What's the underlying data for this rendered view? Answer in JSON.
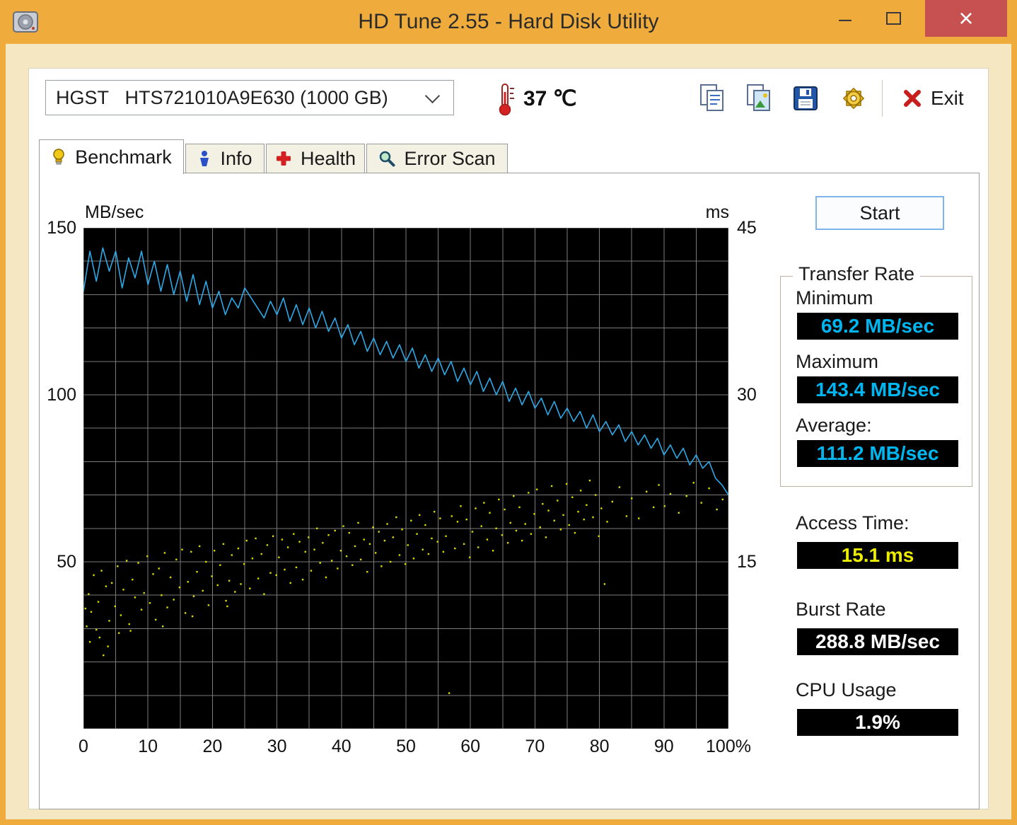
{
  "window": {
    "title": "HD Tune 2.55 - Hard Disk Utility",
    "minimize_glyph": "–",
    "close_glyph": "×"
  },
  "toolbar": {
    "drive_selector_value": "HGST   HTS721010A9E630 (1000 GB)",
    "temperature": "37 ℃",
    "exit_label": "Exit"
  },
  "tabs": [
    {
      "label": "Benchmark",
      "active": true
    },
    {
      "label": "Info",
      "active": false
    },
    {
      "label": "Health",
      "active": false
    },
    {
      "label": "Error Scan",
      "active": false
    }
  ],
  "benchmark": {
    "start_button": "Start",
    "transfer_rate": {
      "group_title": "Transfer Rate",
      "minimum_label": "Minimum",
      "minimum_value": "69.2 MB/sec",
      "maximum_label": "Maximum",
      "maximum_value": "143.4 MB/sec",
      "average_label": "Average:",
      "average_value": "111.2 MB/sec"
    },
    "access_time_label": "Access Time:",
    "access_time_value": "15.1 ms",
    "burst_rate_label": "Burst Rate",
    "burst_rate_value": "288.8 MB/sec",
    "cpu_usage_label": "CPU Usage",
    "cpu_usage_value": "1.9%"
  },
  "chart_data": {
    "type": "line",
    "left_axis": {
      "label": "MB/sec",
      "range": [
        0,
        150
      ],
      "ticks": [
        150,
        100,
        50
      ]
    },
    "right_axis": {
      "label": "ms",
      "range": [
        0,
        45
      ],
      "ticks": [
        45,
        30,
        15
      ]
    },
    "x_axis": {
      "range": [
        0,
        100
      ],
      "tick_labels": [
        "0",
        "10",
        "20",
        "30",
        "40",
        "50",
        "60",
        "70",
        "80",
        "90",
        "100%"
      ]
    },
    "grid": {
      "x_step": 5,
      "y_step_mb": 10,
      "color": "#7a7a7a"
    },
    "legend": "off",
    "colors": {
      "plot_bg": "#000000",
      "transfer_line": "#2ea8e6",
      "access_dots": "#d9d900"
    },
    "series": [
      {
        "name": "transfer-rate",
        "type": "line",
        "axis": "left",
        "unit": "MB/sec",
        "x_start": 0,
        "x_step": 1,
        "values": [
          131,
          143,
          134,
          144,
          137,
          143,
          132,
          141,
          135,
          143,
          133,
          140,
          131,
          139,
          130,
          137,
          128,
          136,
          127,
          134,
          126,
          131,
          124,
          129,
          126,
          132,
          129,
          126,
          123,
          128,
          124,
          129,
          122,
          127,
          121,
          126,
          120,
          125,
          119,
          123,
          117,
          121,
          115,
          119,
          113,
          117,
          112,
          116,
          111,
          115,
          110,
          114,
          108,
          112,
          107,
          111,
          106,
          110,
          104,
          108,
          103,
          107,
          101,
          105,
          100,
          104,
          98,
          102,
          97,
          101,
          96,
          99,
          94,
          98,
          93,
          96,
          92,
          95,
          90,
          94,
          89,
          92,
          88,
          91,
          86,
          89,
          85,
          88,
          84,
          87,
          82,
          85,
          81,
          84,
          79,
          82,
          78,
          80,
          75,
          73,
          70
        ]
      },
      {
        "name": "access-time",
        "type": "scatter",
        "axis": "right",
        "unit": "ms",
        "points": [
          [
            0.3,
            10.8
          ],
          [
            0.5,
            9.2
          ],
          [
            0.8,
            12.1
          ],
          [
            1.0,
            7.8
          ],
          [
            1.2,
            10.5
          ],
          [
            1.6,
            13.8
          ],
          [
            2.0,
            8.9
          ],
          [
            2.3,
            11.4
          ],
          [
            2.5,
            8.2
          ],
          [
            2.8,
            14.2
          ],
          [
            3.1,
            6.6
          ],
          [
            3.5,
            12.8
          ],
          [
            3.8,
            7.4
          ],
          [
            4.0,
            9.7
          ],
          [
            4.4,
            13.1
          ],
          [
            4.9,
            11.0
          ],
          [
            5.3,
            14.6
          ],
          [
            5.5,
            8.6
          ],
          [
            5.8,
            10.2
          ],
          [
            6.2,
            12.5
          ],
          [
            6.7,
            15.1
          ],
          [
            7.1,
            9.4
          ],
          [
            7.3,
            8.8
          ],
          [
            7.6,
            13.4
          ],
          [
            8.0,
            11.8
          ],
          [
            8.5,
            14.9
          ],
          [
            9.0,
            10.7
          ],
          [
            9.4,
            12.2
          ],
          [
            9.9,
            15.5
          ],
          [
            10.3,
            11.3
          ],
          [
            10.8,
            13.9
          ],
          [
            11.2,
            9.8
          ],
          [
            11.7,
            14.4
          ],
          [
            12.1,
            12.0
          ],
          [
            12.3,
            9.2
          ],
          [
            12.6,
            15.8
          ],
          [
            13.0,
            10.9
          ],
          [
            13.5,
            13.6
          ],
          [
            14.0,
            11.6
          ],
          [
            14.4,
            15.2
          ],
          [
            14.9,
            12.7
          ],
          [
            15.3,
            16.1
          ],
          [
            15.8,
            10.4
          ],
          [
            16.2,
            13.2
          ],
          [
            16.7,
            15.9
          ],
          [
            16.9,
            10.1
          ],
          [
            17.1,
            11.9
          ],
          [
            17.6,
            14.1
          ],
          [
            18.0,
            16.4
          ],
          [
            18.5,
            12.4
          ],
          [
            19.0,
            15.0
          ],
          [
            19.4,
            11.1
          ],
          [
            19.9,
            13.7
          ],
          [
            20.3,
            16.0
          ],
          [
            20.8,
            12.9
          ],
          [
            21.2,
            14.7
          ],
          [
            21.7,
            16.6
          ],
          [
            22.1,
            11.5
          ],
          [
            22.3,
            11.0
          ],
          [
            22.6,
            13.3
          ],
          [
            23.0,
            15.6
          ],
          [
            23.5,
            12.3
          ],
          [
            24.0,
            16.2
          ],
          [
            24.4,
            13.0
          ],
          [
            24.9,
            14.8
          ],
          [
            25.3,
            16.9
          ],
          [
            25.8,
            12.6
          ],
          [
            26.2,
            15.3
          ],
          [
            26.7,
            17.1
          ],
          [
            27.1,
            13.5
          ],
          [
            27.6,
            15.7
          ],
          [
            28.0,
            12.1
          ],
          [
            28.5,
            16.5
          ],
          [
            29.0,
            14.0
          ],
          [
            29.4,
            17.3
          ],
          [
            29.9,
            13.8
          ],
          [
            30.3,
            15.4
          ],
          [
            30.8,
            17.0
          ],
          [
            31.2,
            14.3
          ],
          [
            31.7,
            16.3
          ],
          [
            32.1,
            13.1
          ],
          [
            32.6,
            17.5
          ],
          [
            33.0,
            14.5
          ],
          [
            33.5,
            16.8
          ],
          [
            34.0,
            13.4
          ],
          [
            34.4,
            15.9
          ],
          [
            34.9,
            17.2
          ],
          [
            35.3,
            14.2
          ],
          [
            35.8,
            16.1
          ],
          [
            36.2,
            18.0
          ],
          [
            36.7,
            14.9
          ],
          [
            37.1,
            16.7
          ],
          [
            37.6,
            13.6
          ],
          [
            38.0,
            17.4
          ],
          [
            38.5,
            15.1
          ],
          [
            39.0,
            17.8
          ],
          [
            39.4,
            14.4
          ],
          [
            39.9,
            16.0
          ],
          [
            40.3,
            18.2
          ],
          [
            40.8,
            15.5
          ],
          [
            41.2,
            17.6
          ],
          [
            41.7,
            14.7
          ],
          [
            42.1,
            16.4
          ],
          [
            42.6,
            18.5
          ],
          [
            43.0,
            15.2
          ],
          [
            43.5,
            17.0
          ],
          [
            44.0,
            14.1
          ],
          [
            44.4,
            16.6
          ],
          [
            44.9,
            18.1
          ],
          [
            45.3,
            15.8
          ],
          [
            45.8,
            17.7
          ],
          [
            46.2,
            14.6
          ],
          [
            46.7,
            16.9
          ],
          [
            47.1,
            18.4
          ],
          [
            47.6,
            15.0
          ],
          [
            48.0,
            17.2
          ],
          [
            48.5,
            19.0
          ],
          [
            49.0,
            15.6
          ],
          [
            49.4,
            17.9
          ],
          [
            49.9,
            14.8
          ],
          [
            50.3,
            16.5
          ],
          [
            50.8,
            18.7
          ],
          [
            51.2,
            15.3
          ],
          [
            51.7,
            17.5
          ],
          [
            52.1,
            19.2
          ],
          [
            52.6,
            16.1
          ],
          [
            53.0,
            18.3
          ],
          [
            53.5,
            15.7
          ],
          [
            54.0,
            17.1
          ],
          [
            54.4,
            19.5
          ],
          [
            54.9,
            16.8
          ],
          [
            55.3,
            18.9
          ],
          [
            55.8,
            15.9
          ],
          [
            56.2,
            17.3
          ],
          [
            56.7,
            3.2
          ],
          [
            57.1,
            19.1
          ],
          [
            57.6,
            16.2
          ],
          [
            58.0,
            18.6
          ],
          [
            58.5,
            20.0
          ],
          [
            59.0,
            16.6
          ],
          [
            59.4,
            18.8
          ],
          [
            59.9,
            15.4
          ],
          [
            60.3,
            17.7
          ],
          [
            60.8,
            19.8
          ],
          [
            61.2,
            16.3
          ],
          [
            61.7,
            18.2
          ],
          [
            62.1,
            20.3
          ],
          [
            62.6,
            17.0
          ],
          [
            63.0,
            19.4
          ],
          [
            63.5,
            16.0
          ],
          [
            64.0,
            18.0
          ],
          [
            64.4,
            20.6
          ],
          [
            64.9,
            17.4
          ],
          [
            65.3,
            19.7
          ],
          [
            65.8,
            16.7
          ],
          [
            66.2,
            18.5
          ],
          [
            66.7,
            20.9
          ],
          [
            67.1,
            17.8
          ],
          [
            67.6,
            19.9
          ],
          [
            68.0,
            16.9
          ],
          [
            68.5,
            18.4
          ],
          [
            69.0,
            21.2
          ],
          [
            69.4,
            17.5
          ],
          [
            69.9,
            19.3
          ],
          [
            70.3,
            21.5
          ],
          [
            70.8,
            18.1
          ],
          [
            71.2,
            20.2
          ],
          [
            71.7,
            17.2
          ],
          [
            72.1,
            19.6
          ],
          [
            72.6,
            21.8
          ],
          [
            73.0,
            18.7
          ],
          [
            73.5,
            20.5
          ],
          [
            74.0,
            17.9
          ],
          [
            74.4,
            19.2
          ],
          [
            74.9,
            22.0
          ],
          [
            75.3,
            18.3
          ],
          [
            75.8,
            20.8
          ],
          [
            76.2,
            17.6
          ],
          [
            76.7,
            19.5
          ],
          [
            77.1,
            21.4
          ],
          [
            77.6,
            18.8
          ],
          [
            78.0,
            20.1
          ],
          [
            78.5,
            22.3
          ],
          [
            79.0,
            19.0
          ],
          [
            79.4,
            21.0
          ],
          [
            79.9,
            17.3
          ],
          [
            80.3,
            19.8
          ],
          [
            80.8,
            13.0
          ],
          [
            81.2,
            18.6
          ],
          [
            82.0,
            20.4
          ],
          [
            83.1,
            21.7
          ],
          [
            84.2,
            19.1
          ],
          [
            85.0,
            20.7
          ],
          [
            86.1,
            18.9
          ],
          [
            87.3,
            21.3
          ],
          [
            88.4,
            19.9
          ],
          [
            89.2,
            21.9
          ],
          [
            90.1,
            20.0
          ],
          [
            91.0,
            21.1
          ],
          [
            92.3,
            19.4
          ],
          [
            93.5,
            20.9
          ],
          [
            94.6,
            22.1
          ],
          [
            95.8,
            20.3
          ],
          [
            97.0,
            21.6
          ],
          [
            98.2,
            19.7
          ],
          [
            99.1,
            20.6
          ]
        ]
      }
    ]
  }
}
